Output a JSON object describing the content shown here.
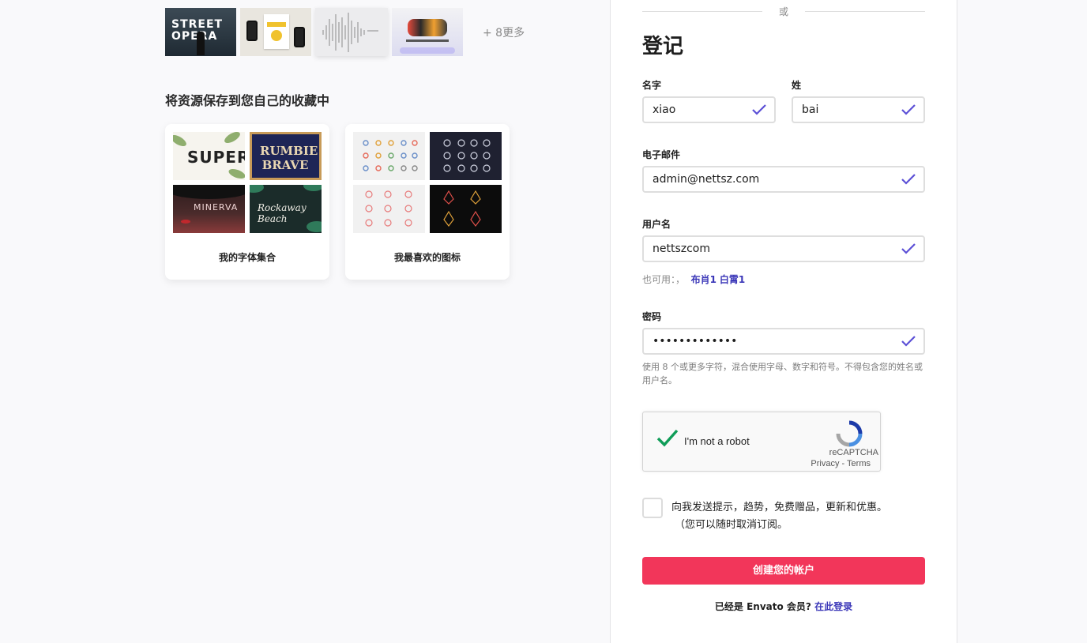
{
  "left": {
    "thumbnails": {
      "street_text": "STREET OPERA",
      "more_label": "+ 8更多"
    },
    "save_title": "将资源保存到您自己的收藏中",
    "collections": [
      {
        "label": "我的字体集合",
        "previews": [
          "SUPER",
          "RUMBIE BRAVE",
          "MINERVA",
          "Rockaway Beach"
        ]
      },
      {
        "label": "我最喜欢的图标"
      }
    ]
  },
  "form": {
    "or_label": "或",
    "heading": "登记",
    "first_name": {
      "label": "名字",
      "value": "xiao"
    },
    "last_name": {
      "label": "姓",
      "value": "bai"
    },
    "email": {
      "label": "电子邮件",
      "value": "admin@nettsz.com"
    },
    "username": {
      "label": "用户名",
      "value": "nettszcom"
    },
    "available": {
      "prefix": "也可用：，",
      "suggestion1": "布肖1",
      "suggestion2": "白霄1"
    },
    "password": {
      "label": "密码",
      "value": "•••••••••••••"
    },
    "password_hint": "使用 8 个或更多字符，混合使用字母、数字和符号。不得包含您的姓名或用户名。",
    "captcha": {
      "text": "I'm not a robot",
      "brand": "reCAPTCHA",
      "links": "Privacy - Terms"
    },
    "optin": {
      "line1": "向我发送提示，趋势，免费赠品，更新和优惠。",
      "line2": "（您可以随时取消订阅。"
    },
    "submit_label": "创建您的帐户",
    "login_prefix": "已经是 Envato 会员?",
    "login_link": "在此登录"
  },
  "colors": {
    "accent": "#f2365a",
    "link": "#3b37b8",
    "check": "#5b4fd6",
    "captcha_check": "#0f9d58"
  }
}
